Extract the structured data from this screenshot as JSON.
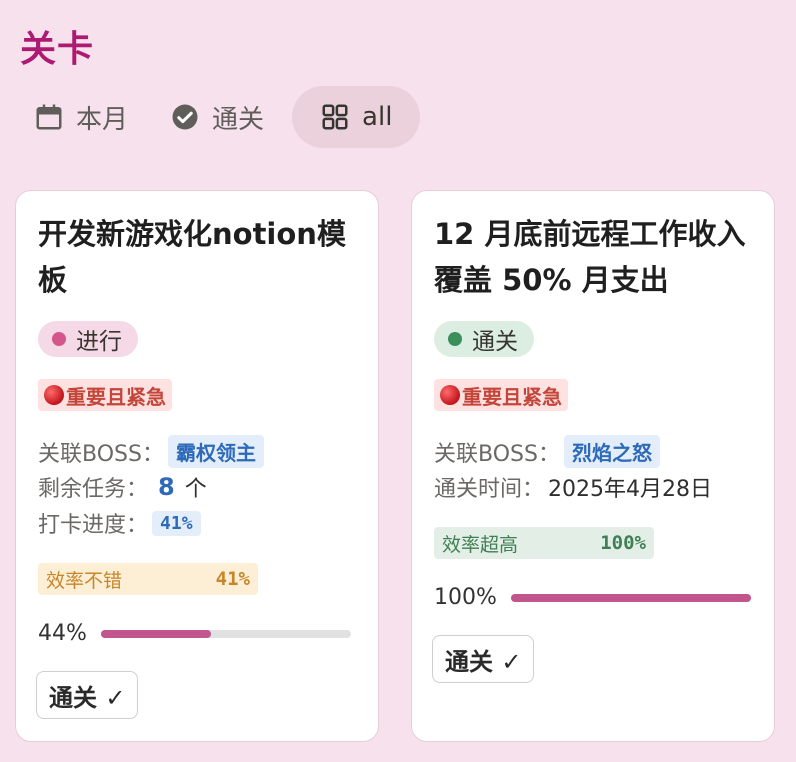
{
  "page_title": "关卡",
  "tabs": [
    {
      "label": "本月",
      "icon": "calendar-icon"
    },
    {
      "label": "通关",
      "icon": "check-circle-icon"
    },
    {
      "label": "all",
      "icon": "grid-icon"
    }
  ],
  "colors": {
    "background": "#f7e1ec",
    "title": "#ad1a72",
    "progress_fill": "#c1558d"
  },
  "cards": [
    {
      "title": "开发新游戏化notion模板",
      "status": {
        "label": "进行",
        "color": "#d5558d",
        "bg": "#f6d9e6"
      },
      "priority": "重要且紧急",
      "boss_label": "关联BOSS：",
      "boss": "霸权领主",
      "remaining_label": "剩余任务：",
      "remaining_count": "8",
      "remaining_unit": "个",
      "checkin_label": "打卡进度：",
      "checkin_value": "41%",
      "efficiency_label": "效率不错",
      "efficiency_value": "41%",
      "progress_text": "44%",
      "progress": 0.44,
      "button": "通关 ✓"
    },
    {
      "title": "12 月底前远程工作收入覆盖 50% 月支出",
      "status": {
        "label": "通关",
        "color": "#3a8f5a",
        "bg": "#dcede2"
      },
      "priority": "重要且紧急",
      "boss_label": "关联BOSS：",
      "boss": "烈焰之怒",
      "clear_time_label": "通关时间：",
      "clear_time": "2025年4月28日",
      "efficiency_label": "效率超高",
      "efficiency_value": "100%",
      "progress_text": "100%",
      "progress": 1.0,
      "button": "通关 ✓"
    }
  ]
}
